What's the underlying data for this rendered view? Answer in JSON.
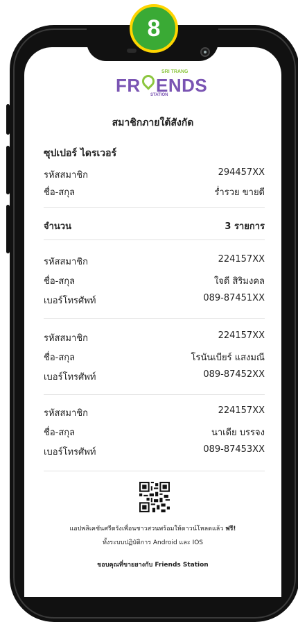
{
  "step_number": "8",
  "logo": {
    "top": "SRI TRANG",
    "main_left": "FR",
    "main_right": "ENDS",
    "bottom": "STATION"
  },
  "title": "สมาชิกภายใต้สังกัด",
  "driver": {
    "heading": "ซุปเปอร์ ไดรเวอร์",
    "member_id_label": "รหัสสมาชิก",
    "member_id": "294457XX",
    "name_label": "ชื่อ-สกุล",
    "name": "ร่ำรวย ขายดี"
  },
  "count": {
    "label": "จำนวน",
    "value": "3 รายการ"
  },
  "members": [
    {
      "id_label": "รหัสสมาชิก",
      "id": "224157XX",
      "name_label": "ชื่อ-สกุล",
      "name": "ใจดี สิริมงคล",
      "phone_label": "เบอร์โทรศัพท์",
      "phone": "089-87451XX"
    },
    {
      "id_label": "รหัสสมาชิก",
      "id": "224157XX",
      "name_label": "ชื่อ-สกุล",
      "name": "โรนันเบียร์  แสงมณี",
      "phone_label": "เบอร์โทรศัพท์",
      "phone": "089-87452XX"
    },
    {
      "id_label": "รหัสสมาชิก",
      "id": "224157XX",
      "name_label": "ชื่อ-สกุล",
      "name": "นาเดีย  บรรจง",
      "phone_label": "เบอร์โทรศัพท์",
      "phone": "089-87453XX"
    }
  ],
  "footer": {
    "line1": "แอปพลิเคชันศรีตรังเพื่อนชาวสวนพร้อมให้ดาวน์โหลดแล้ว ",
    "free": "ฟรี!",
    "line2": "ทั้งระบบปฏิบัติการ Android และ IOS",
    "thanks": "ขอบคุณที่ขายยางกับ Friends Station"
  },
  "colors": {
    "badge_green": "#3aaa35",
    "badge_ring": "#ffd500",
    "brand_purple": "#7a54b3",
    "brand_green": "#8cc63f"
  }
}
